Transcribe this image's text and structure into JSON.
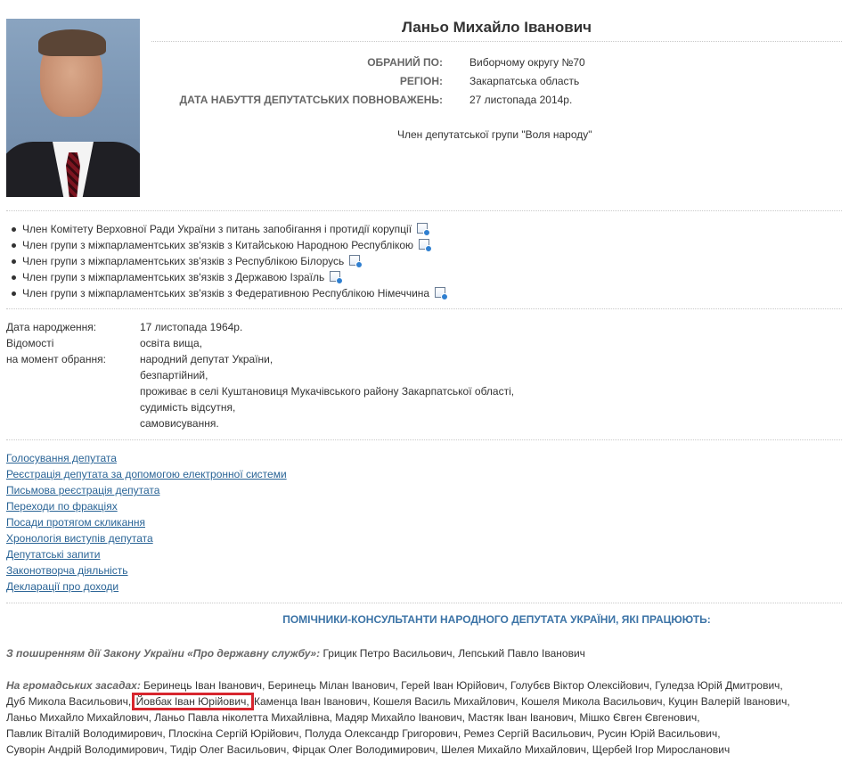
{
  "deputy": {
    "name": "Ланьо Михайло Іванович",
    "photo_alt": "deputy-photo"
  },
  "properties": [
    {
      "label": "ОБРАНИЙ ПО:",
      "value": "Виборчому округу №70"
    },
    {
      "label": "РЕГІОН:",
      "value": "Закарпатська область"
    },
    {
      "label": "ДАТА НАБУТТЯ ДЕПУТАТСЬКИХ ПОВНОВАЖЕНЬ:",
      "value": "27 листопада 2014р."
    }
  ],
  "group_membership": "Член депутатської групи \"Воля народу\"",
  "memberships": [
    "Член Комітету Верховної Ради України з питань запобігання і протидії корупції",
    "Член групи з міжпарламентських зв'язків з Китайською Народною Республікою",
    "Член групи з міжпарламентських зв'язків з Республікою Білорусь",
    "Член групи з міжпарламентських зв'язків з Державою Ізраїль",
    "Член групи з міжпарламентських зв'язків з Федеративною Республікою Німеччина"
  ],
  "bio": {
    "birth_label": "Дата народження:",
    "birth_value": "17 листопада 1964р.",
    "info_label_1": "Відомості",
    "info_label_2": "на момент обрання:",
    "info_lines": [
      "освіта вища,",
      "народний депутат України,",
      "безпартійний,",
      "проживає в селі Куштановиця Мукачівського району Закарпатської області,",
      "судимість відсутня,",
      "самовисування."
    ]
  },
  "links": [
    "Голосування депутата",
    "Реєстрація депутата за допомогою електронної системи",
    "Письмова реєстрація депутата",
    "Переходи по фракціях",
    "Посади протягом скликання",
    "Хронологія виступів депутата",
    "Депутатські запити",
    "Законотворча діяльність",
    "Декларації про доходи"
  ],
  "assistants": {
    "title": "ПОМІЧНИКИ-КОНСУЛЬТАНТИ НАРОДНОГО ДЕПУТАТА УКРАЇНИ, ЯКІ ПРАЦЮЮТЬ:",
    "civil_service_lead": "З поширенням дії Закону України «Про державну службу»:",
    "civil_service_names": " Грицик Петро Васильович, Лепський Павло Іванович",
    "public_lead": "На громадських засадах:",
    "public_line_1": " Беринець Іван Іванович, Беринець Мілан Іванович, Герей Іван Юрійович, Голубєв Віктор Олексійович, Гуледза Юрій Дмитрович,",
    "public_line_2_pre": "Дуб Микола Васильович,",
    "public_line_2_highlight": "Йовбак Іван Юрійович,",
    "public_line_2_post": " Каменца Іван Іванович, Кошеля Василь Михайлович, Кошеля Микола Васильович, Куцин Валерій Іванович,",
    "public_line_3": "Ланьо Михайло Михайлович, Ланьо Павла ніколетта Михайлівна, Мадяр Михайло Іванович, Мастяк Іван Іванович, Мішко Євген Євгенович,",
    "public_line_4": "Павлик Віталій Володимирович, Плоскіна Сергій Юрійович, Полуда Олександр Григорович, Ремез Сергій Васильович, Русин Юрій Васильович,",
    "public_line_5": "Суворін Андрій Володимирович, Тидір Олег Васильович, Фірцак Олег Володимирович, Шелея Михайло Михайлович, Щербей Ігор Миросланович"
  },
  "colors": {
    "link": "#2a6496",
    "assist_title": "#3b73a6",
    "highlight_box": "#d7262e"
  }
}
